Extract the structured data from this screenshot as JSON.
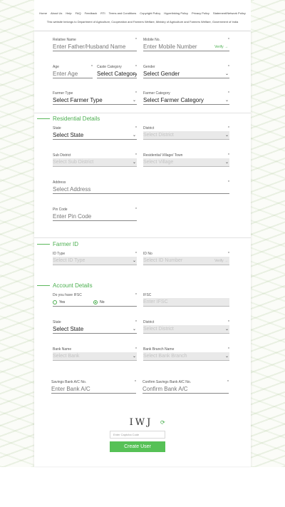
{
  "nav": {
    "links": [
      "Home",
      "About Us",
      "Help",
      "FAQ",
      "Feedback",
      "RTI",
      "Terms and Conditions",
      "Copyright Policy",
      "Hyperlinking Policy",
      "Privacy Policy",
      "Statement/Network Policy"
    ],
    "ownership": "This website belongs to Department of Agriculture, Cooperation and Farmers Welfare, Ministry of Agriculture and Farmers Welfare, Government of India"
  },
  "personal": {
    "relative_name": {
      "label": "Relative Name",
      "placeholder": "Enter Father/Husband Name"
    },
    "mobile": {
      "label": "Mobile No.",
      "placeholder": "Enter Mobile Number",
      "verify": "Verify"
    },
    "age": {
      "label": "Age",
      "placeholder": "Enter Age"
    },
    "caste": {
      "label": "Caste Category",
      "value": "Select Category"
    },
    "gender": {
      "label": "Gender",
      "value": "Select Gender"
    },
    "farmer_type": {
      "label": "Farmer Type",
      "value": "Select Farmer Type"
    },
    "farmer_category": {
      "label": "Farmer Category",
      "value": "Select Farmer Category"
    }
  },
  "residential": {
    "title": "Residential Details",
    "state": {
      "label": "State",
      "value": "Select State"
    },
    "district": {
      "label": "District",
      "value": "Select District"
    },
    "sub_district": {
      "label": "Sub District",
      "value": "Select Sub District"
    },
    "village": {
      "label": "Residential Village/ Town",
      "value": "Select Village"
    },
    "address": {
      "label": "Address",
      "placeholder": "Select Address"
    },
    "pincode": {
      "label": "Pin Code",
      "placeholder": "Enter Pin Code"
    }
  },
  "farmer_id": {
    "title": "Farmer ID",
    "id_type": {
      "label": "ID Type",
      "value": "Select ID Type"
    },
    "id_no": {
      "label": "ID No",
      "placeholder": "Select ID Number",
      "verify": "Verify"
    }
  },
  "account": {
    "title": "Account Details",
    "ifsc_question": {
      "label": "Do you have IFSC",
      "yes": "Yes",
      "no": "No",
      "selected": "No"
    },
    "ifsc": {
      "label": "IFSC",
      "placeholder": "Enter IFSC"
    },
    "state": {
      "label": "State",
      "value": "Select State"
    },
    "district": {
      "label": "District",
      "value": "Select District"
    },
    "bank_name": {
      "label": "Bank Name",
      "value": "Select Bank"
    },
    "branch_name": {
      "label": "Bank Branch Name",
      "value": "Select Bank Branch"
    },
    "account_no": {
      "label": "Savings Bank A/C No.",
      "placeholder": "Enter Bank A/C"
    },
    "confirm_account_no": {
      "label": "Confirm Savings Bank A/C No.",
      "placeholder": "Confirm Bank A/C"
    }
  },
  "captcha": {
    "text": "IWJ",
    "placeholder": "Enter Captcha Code",
    "refresh_icon": "refresh-icon"
  },
  "submit": {
    "label": "Create User"
  },
  "colors": {
    "accent": "#4caf50",
    "button": "#56c156",
    "disabled": "#e9e9e9"
  }
}
